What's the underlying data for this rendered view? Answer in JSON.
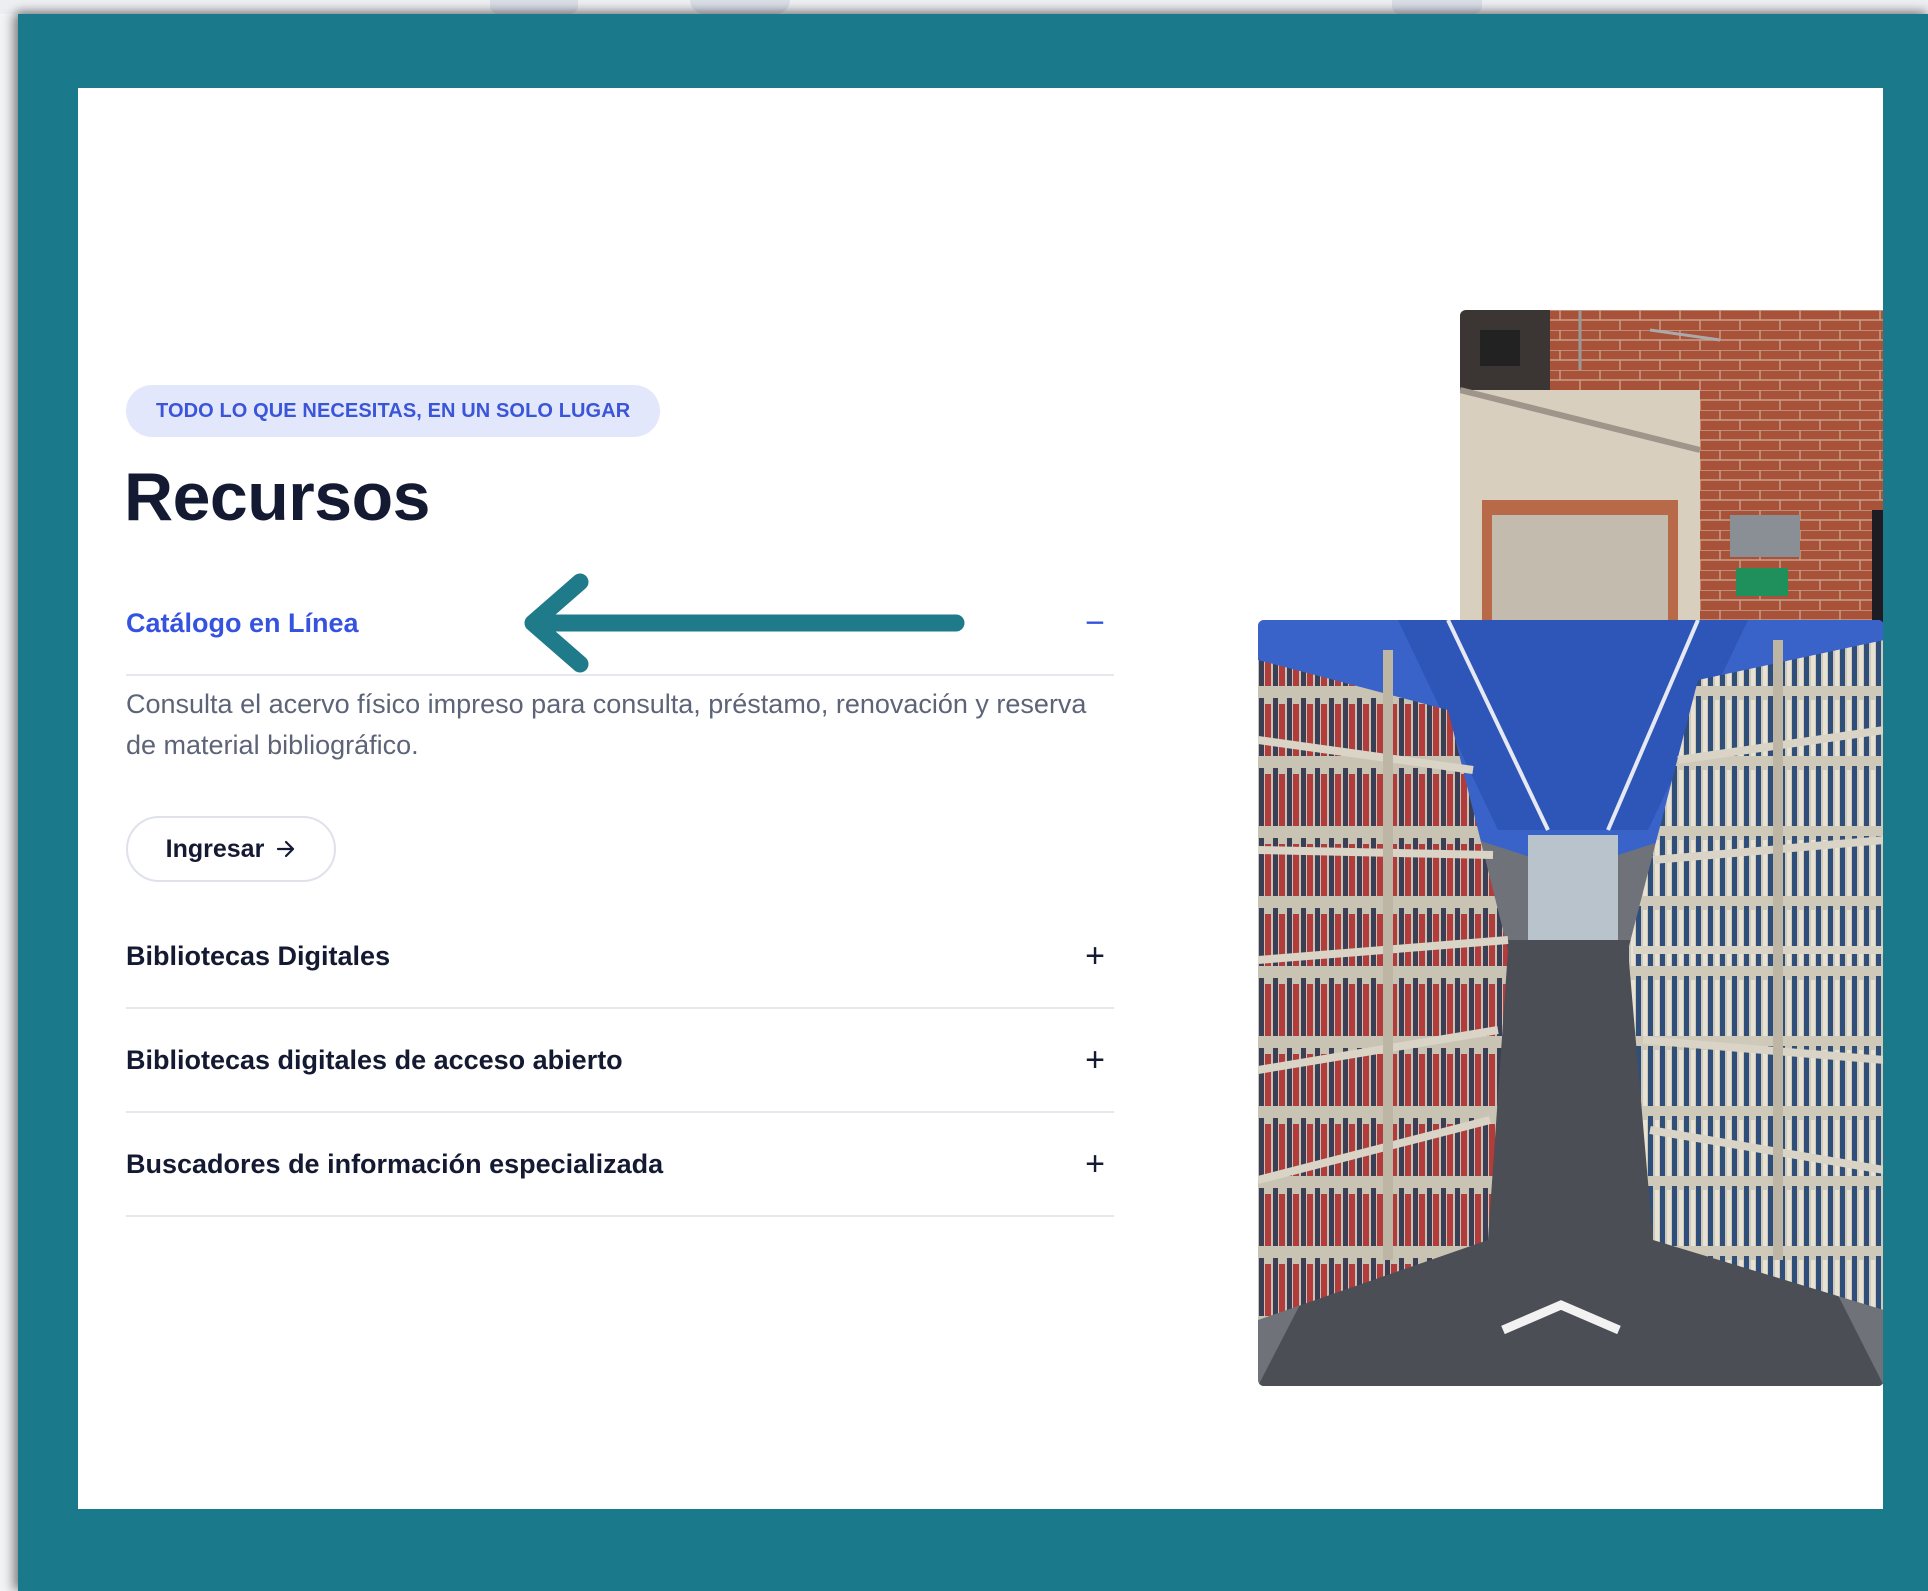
{
  "section": {
    "eyebrow": "TODO LO QUE NECESITAS, EN UN SOLO LUGAR",
    "title": "Recursos"
  },
  "accordion": {
    "active": {
      "label": "Catálogo en Línea",
      "toggle": "−",
      "description": "Consulta el acervo físico impreso para consulta, préstamo, renovación y reserva de material bibliográfico.",
      "button_label": "Ingresar"
    },
    "items": [
      {
        "label": "Bibliotecas Digitales",
        "toggle": "+"
      },
      {
        "label": "Bibliotecas digitales de acceso abierto",
        "toggle": "+"
      },
      {
        "label": "Buscadores de información especializada",
        "toggle": "+"
      }
    ]
  },
  "icons": {
    "button_icon": "arrow-right-icon",
    "annotation": "annotation-arrow-left-icon"
  },
  "colors": {
    "frame": "#1a7a8c",
    "accent": "#3653e0",
    "eyebrow_bg": "#e3e7fb",
    "heading": "#151a33",
    "body_text": "#5d6478"
  }
}
